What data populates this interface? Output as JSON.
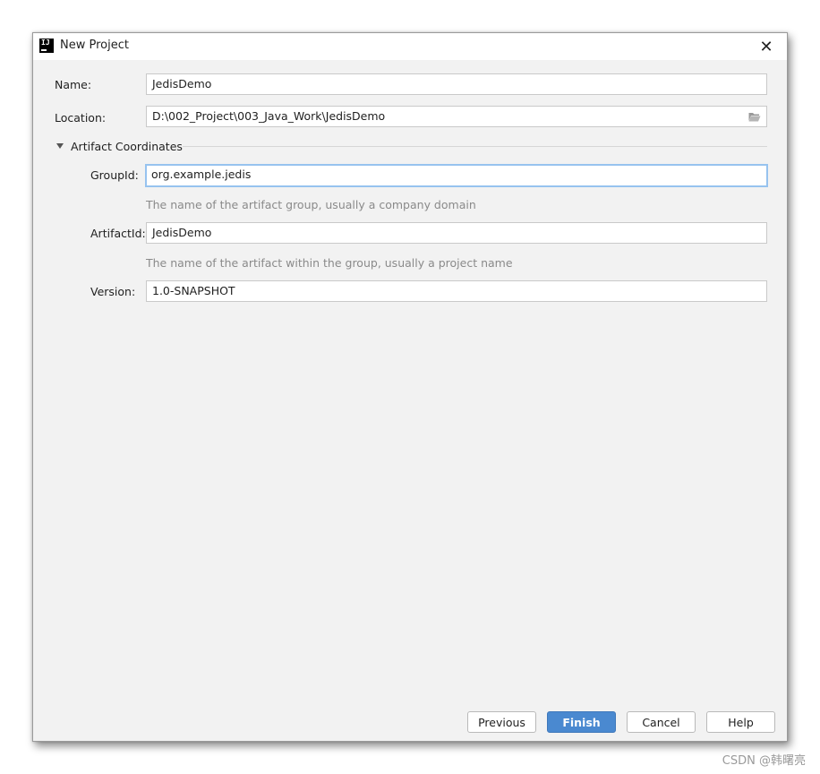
{
  "window": {
    "title": "New Project",
    "logo_text": "IJ",
    "close_glyph": "✕"
  },
  "form": {
    "name": {
      "label": "Name:",
      "value": "JedisDemo"
    },
    "location": {
      "label": "Location:",
      "value": "D:\\002_Project\\003_Java_Work\\JedisDemo",
      "icon": "folder-icon"
    },
    "section": {
      "label": "Artifact Coordinates",
      "expanded": true
    },
    "group_id": {
      "label": "GroupId:",
      "value": "org.example.jedis",
      "hint": "The name of the artifact group, usually a company domain"
    },
    "artifact_id": {
      "label": "ArtifactId:",
      "value": "JedisDemo",
      "hint": "The name of the artifact within the group, usually a project name"
    },
    "version": {
      "label": "Version:",
      "value": "1.0-SNAPSHOT"
    }
  },
  "buttons": {
    "previous": "Previous",
    "finish": "Finish",
    "cancel": "Cancel",
    "help": "Help"
  },
  "watermark": "CSDN @韩曙亮",
  "colors": {
    "primary": "#4a89d0",
    "focus_ring": "#97c3ef",
    "dialog_bg": "#f2f2f2"
  }
}
